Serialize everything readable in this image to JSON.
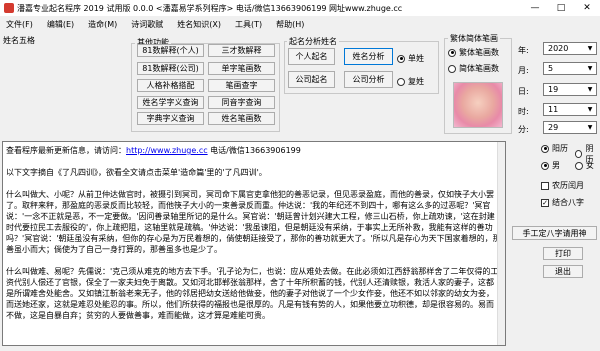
{
  "window": {
    "title": "潘嘉专业起名程序  2019 试用版 0.0.0    <潘嘉易学系列程序>    电话/微信13663906199  网址www.zhuge.cc"
  },
  "menu": [
    "文件(F)",
    "编辑(E)",
    "造命(M)",
    "诗词歌赋",
    "姓名知识(X)",
    "工具(T)",
    "帮助(H)"
  ],
  "left_panel": {
    "label": "姓名五格",
    "other_functions": "其他功能",
    "buttons": [
      [
        "81数解释(个人)",
        "三才数解释"
      ],
      [
        "81数解释(公司)",
        "单字笔画数"
      ],
      [
        "人格补格搭配",
        "笔画查字"
      ],
      [
        "姓名学字义查询",
        "同音字查询"
      ],
      [
        "字典字义查询",
        "姓名笔画数"
      ]
    ]
  },
  "analysis": {
    "label": "起名分析姓名",
    "personal_name_btn": "个人起名",
    "name_analysis_btn": "姓名分析",
    "company_name_btn": "公司起名",
    "company_analysis_btn": "公司分析",
    "single_surname": "单姓",
    "double_surname": "复姓"
  },
  "strokes": {
    "label": "繁体简体笔画",
    "traditional": "繁体笔画数",
    "simplified": "简体笔画数"
  },
  "date": {
    "year_label": "年:",
    "year_value": "2020",
    "month_label": "月:",
    "month_value": "5",
    "day_label": "日:",
    "day_value": "19",
    "hour_label": "时:",
    "hour_value": "11",
    "minute_label": "分:",
    "minute_value": "29"
  },
  "calendar": {
    "solar": "阳历",
    "lunar": "阴历"
  },
  "gender": {
    "male": "男",
    "female": "女"
  },
  "options": {
    "lunar_leap": "农历闰月",
    "bazi": "结合八字"
  },
  "side_buttons": {
    "bazi_manual": "手工定八字请用神",
    "print": "打印",
    "exit": "退出"
  },
  "content": {
    "header_prefix": "查看程序最新更新信息，请访问：",
    "header_link": "http://www.zhuge.cc",
    "header_suffix": " 电话/微信13663906199",
    "intro": "以下文字摘自《了凡四训》，欲看全文请点击菜单'造命篇'里的'了凡四训'。",
    "para1": "    什么叫做大、小呢？从前卫仲达做官时，被摄引到冥司，冥司命下属官吏拿他犯的善恶记录，但见恶录盈庭，而他的善录，仅如筷子大小罢了。取秤来秤，那盈庭的恶录反而比较轻，而他筷子大小的一束善录反而重。仲达说：'我的年纪还不到四十，哪有这么多的过恶呢？'冥官说：'一念不正就是恶，不一定要做。'因问善录轴里所记的是什么。冥官说：'朝廷曾计划兴建大工程，修三山石桥，你上疏劝谏，'这在封建时代要拉民工去服役的'，你上疏把阻，这轴里就是疏稿。'仲达说：'我虽谏阻，但是朝廷没有采纳，于事实上无所补救，我能有这样的善功吗？'冥官说：'朝廷虽没有采纳，但你的存心是为万民着想的，倘使朝廷接受了，那你的善功就更大了。'所以凡是存心为天下国家着想的，那善虽小而大；倘使为了自己一身打算的，那善虽多也是少了。",
    "para2": "    什么叫做难、易呢？先儒说：'克己须从难克的地方去下手。'孔子论为仁，也说：应从难处去做。在此必须如江西舒翁那样舍了二年仅得的工资代别人偿还了官银，保全了一家夫妇免于离散。又如河北邯郸张翁那样，舍了十年所积蓄的钱，代别人还清赎银，救活人家的妻子，这都是所谓难舍处能舍。又如镇江靳翁老来无子，他的邻居把幼女送给他做妾，他的妻子对他说了一个少女作妾，他还不如以邻家的幼女为妾，而送她还家，这就是难忍处能忍的事。所以，他们所获得的福报也是很厚的。凡是有钱有势的人，如果他要立功积德，却是很容易的。易而不做，这是自暴自弃；贫穷的人要做善事，难而能做，这才算是难能可贵。"
  }
}
